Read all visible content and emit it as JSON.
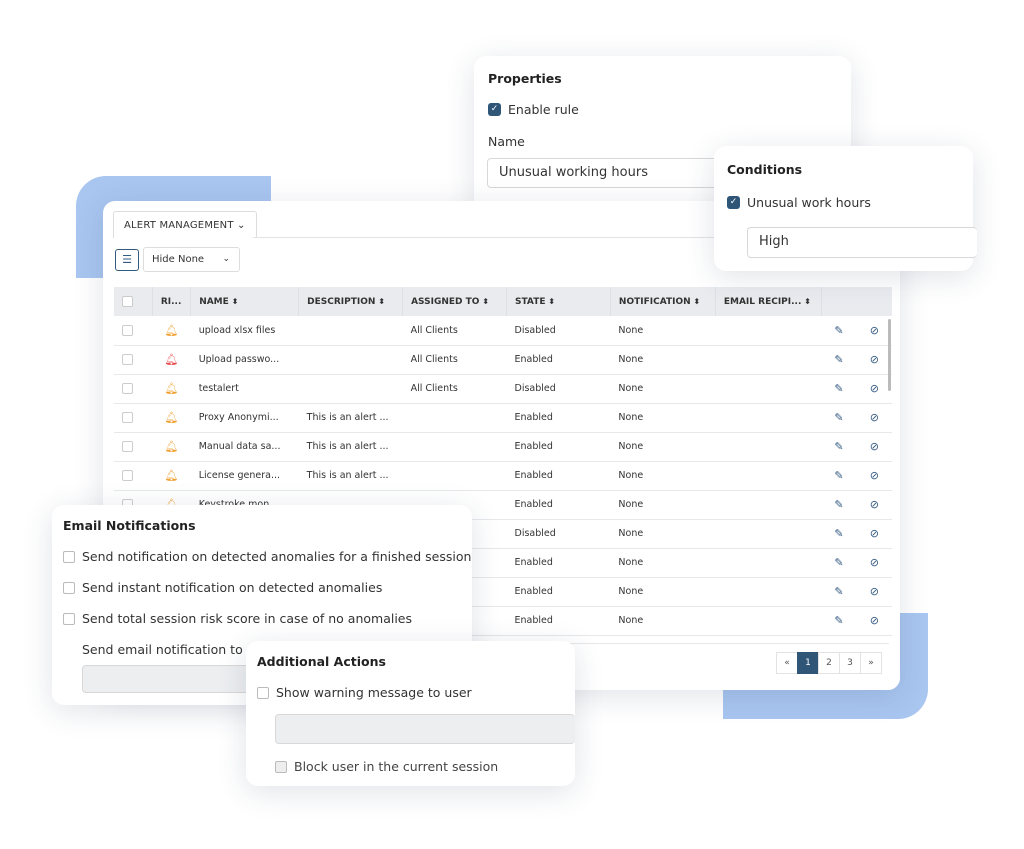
{
  "colors": {
    "accent": "#2f5577",
    "decor_blue": "#a8c6f0",
    "risk_medium": "#f0a030",
    "risk_high": "#e84a4a"
  },
  "main": {
    "tab_label": "ALERT MANAGEMENT",
    "view_icon": "list-icon",
    "filter_value": "Hide None",
    "columns": [
      "RI...",
      "NAME",
      "DESCRIPTION",
      "ASSIGNED TO",
      "STATE",
      "NOTIFICATION",
      "EMAIL RECIPI..."
    ],
    "rows": [
      {
        "risk": "medium",
        "name": "upload xlsx files",
        "description": "",
        "assigned": "All Clients",
        "state": "Disabled",
        "notification": "None",
        "email": ""
      },
      {
        "risk": "high",
        "name": "Upload passwo...",
        "description": "",
        "assigned": "All Clients",
        "state": "Enabled",
        "notification": "None",
        "email": ""
      },
      {
        "risk": "medium",
        "name": "testalert",
        "description": "",
        "assigned": "All Clients",
        "state": "Disabled",
        "notification": "None",
        "email": ""
      },
      {
        "risk": "medium",
        "name": "Proxy Anonymi...",
        "description": "This is an alert ...",
        "assigned": "",
        "state": "Enabled",
        "notification": "None",
        "email": ""
      },
      {
        "risk": "medium",
        "name": "Manual data sa...",
        "description": "This is an alert ...",
        "assigned": "",
        "state": "Enabled",
        "notification": "None",
        "email": ""
      },
      {
        "risk": "medium",
        "name": "License genera...",
        "description": "This is an alert ...",
        "assigned": "",
        "state": "Enabled",
        "notification": "None",
        "email": ""
      },
      {
        "risk": "medium",
        "name": "Keystroke mon...",
        "description": "",
        "assigned": "",
        "state": "Enabled",
        "notification": "None",
        "email": ""
      },
      {
        "risk": "",
        "name": "",
        "description": "",
        "assigned": "",
        "state": "Disabled",
        "notification": "None",
        "email": ""
      },
      {
        "risk": "",
        "name": "",
        "description": "",
        "assigned": "",
        "state": "Enabled",
        "notification": "None",
        "email": ""
      },
      {
        "risk": "",
        "name": "",
        "description": "",
        "assigned": "",
        "state": "Enabled",
        "notification": "None",
        "email": ""
      },
      {
        "risk": "",
        "name": "",
        "description": "",
        "assigned": "",
        "state": "Enabled",
        "notification": "None",
        "email": ""
      }
    ],
    "pagination": {
      "prev": "«",
      "pages": [
        "1",
        "2",
        "3"
      ],
      "current": "1",
      "next": "»"
    }
  },
  "properties": {
    "title": "Properties",
    "enable_rule": "Enable rule",
    "enable_checked": true,
    "name_label": "Name",
    "name_value": "Unusual working hours"
  },
  "conditions": {
    "title": "Conditions",
    "option": "Unusual work hours",
    "option_checked": true,
    "level": "High"
  },
  "email": {
    "title": "Email Notifications",
    "options": [
      "Send notification on detected anomalies for a finished session",
      "Send instant notification on detected anomalies",
      "Send total session risk score in case of no anomalies"
    ],
    "send_to_label": "Send email notification to",
    "send_to_value": ""
  },
  "actions": {
    "title": "Additional Actions",
    "warning": "Show warning message to user",
    "warning_value": "",
    "block": "Block user in the current session"
  }
}
